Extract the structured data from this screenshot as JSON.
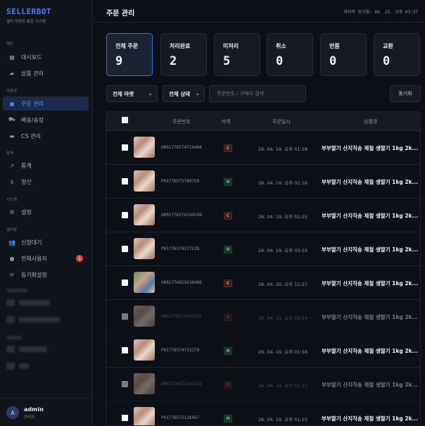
{
  "brand": {
    "name": "SELLERBOT",
    "subtitle": "셀러 자동화 통합 시스템"
  },
  "sidebar": {
    "sections": {
      "main": "메인",
      "automation": "자동화",
      "analysis": "분석",
      "system": "시스템",
      "seller": "셀러봇"
    },
    "items": [
      {
        "label": "대시보드",
        "icon": "dashboard-icon"
      },
      {
        "label": "상품 관리",
        "icon": "tag-icon"
      },
      {
        "label": "주문 관리",
        "icon": "order-icon",
        "active": true
      },
      {
        "label": "배송/송장",
        "icon": "truck-icon"
      },
      {
        "label": "CS 관리",
        "icon": "chat-icon"
      },
      {
        "label": "통계",
        "icon": "trend-icon"
      },
      {
        "label": "정산",
        "icon": "dollar-icon"
      },
      {
        "label": "설정",
        "icon": "gear-icon"
      },
      {
        "label": "신청대기",
        "icon": "users-icon"
      },
      {
        "label": "전체사용자",
        "icon": "user-icon",
        "badge": "1"
      },
      {
        "label": "동기화설정",
        "icon": "sync-icon"
      }
    ]
  },
  "user": {
    "initial": "A",
    "name": "admin",
    "role": "관리자"
  },
  "header": {
    "title": "주문 관리",
    "last_sync": "마지막 동기화: 04. 25. 오후 03:37"
  },
  "stats": [
    {
      "label": "전체 주문",
      "value": "9"
    },
    {
      "label": "처리완료",
      "value": "2"
    },
    {
      "label": "미처리",
      "value": "5"
    },
    {
      "label": "취소",
      "value": "0"
    },
    {
      "label": "반품",
      "value": "0"
    },
    {
      "label": "교환",
      "value": "0"
    }
  ],
  "filters": {
    "market": "전체 마켓",
    "status": "전체 상태",
    "search_placeholder": "주문번호 / 구매자 검색",
    "sync_button": "동기화"
  },
  "table": {
    "columns": {
      "order_no": "주문번호",
      "market": "마켓",
      "date": "주문일시",
      "product": "상품명"
    },
    "rows": [
      {
        "order_no": "OR01776574714484",
        "market": "C",
        "date": "26. 04. 19. 오후 01:58",
        "product": "부부딸기 산지직송 제철 생딸기 1kg 2k...",
        "dim": false
      },
      {
        "order_no": "P01776575789759",
        "market": "N",
        "date": "26. 04. 19. 오후 02:16",
        "product": "부부딸기 산지직송 제철 생딸기 1kg 2k...",
        "dim": false
      },
      {
        "order_no": "OR01776576344599",
        "market": "C",
        "date": "26. 04. 19. 오후 02:25",
        "product": "부부딸기 산지직송 제철 생딸기 1kg 2k...",
        "dim": false
      },
      {
        "order_no": "P01776579277228",
        "market": "N",
        "date": "26. 04. 19. 오후 03:14",
        "product": "부부딸기 산지직송 제철 생딸기 1kg 2k...",
        "dim": false
      },
      {
        "order_no": "OR01776655638486",
        "market": "C",
        "date": "26. 04. 20. 오후 12:27",
        "product": "부부딸기 산지직송 제철 생딸기 1kg 2k...",
        "dim": false
      },
      {
        "order_no": "OR01776579291791",
        "market": "C",
        "date": "26. 04. 19. 오후 03:14",
        "product": "부부딸기 산지직송 제철 생딸기 1kg 2k...",
        "dim": true
      },
      {
        "order_no": "P01776574723279",
        "market": "N",
        "date": "26. 04. 19. 오후 01:58",
        "product": "부부딸기 산지직송 제철 생딸기 1kg 2k...",
        "dim": false
      },
      {
        "order_no": "OR01776572142233",
        "market": "C",
        "date": "26. 04. 19. 오후 01:15",
        "product": "부부딸기 산지직송 제철 생딸기 1kg 2k...",
        "dim": true
      },
      {
        "order_no": "P01776572126967",
        "market": "N",
        "date": "26. 04. 19. 오후 01:15",
        "product": "부부딸기 산지직송 제철 생딸기 1kg 2k...",
        "dim": false
      }
    ]
  }
}
